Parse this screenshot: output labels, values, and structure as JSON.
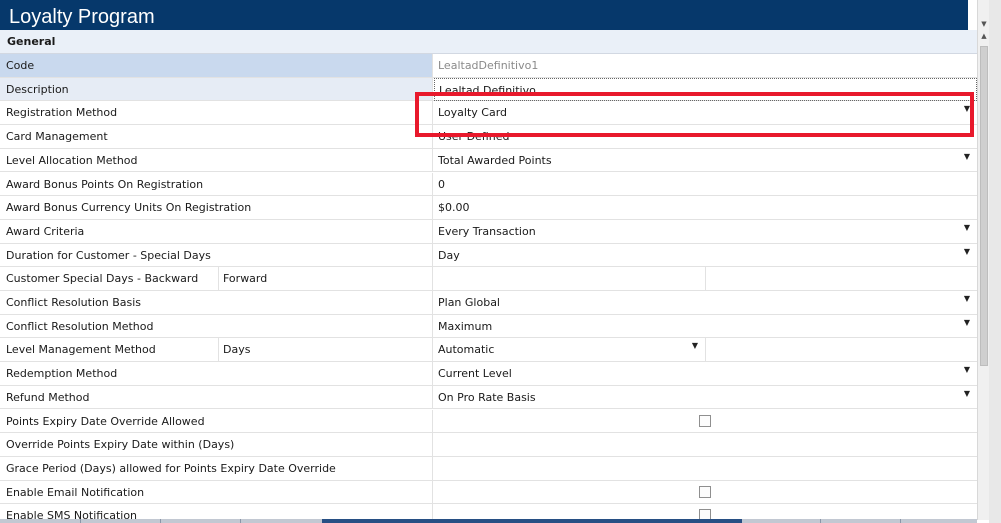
{
  "window": {
    "title": "Loyalty Program"
  },
  "category": {
    "label": "General"
  },
  "properties": {
    "code": {
      "label": "Code",
      "value": "LealtadDefinitivo1"
    },
    "description": {
      "label": "Description",
      "value": "Lealtad Definitivo"
    },
    "registration_method": {
      "label": "Registration Method",
      "value": "Loyalty Card"
    },
    "card_management": {
      "label": "Card Management",
      "value": "User Defined"
    },
    "level_allocation_method": {
      "label": "Level Allocation Method",
      "value": "Total Awarded Points"
    },
    "award_bonus_points": {
      "label": "Award Bonus Points On Registration",
      "value": "0"
    },
    "award_bonus_currency": {
      "label": "Award Bonus Currency Units On Registration",
      "value": "$0.00"
    },
    "award_criteria": {
      "label": "Award Criteria",
      "value": "Every Transaction"
    },
    "duration_special_days": {
      "label": "Duration for Customer - Special Days",
      "value": "Day"
    },
    "special_days_backward": {
      "label": "Customer Special Days - Backward",
      "sublabel": "Forward"
    },
    "conflict_resolution_basis": {
      "label": "Conflict Resolution Basis",
      "value": "Plan Global"
    },
    "conflict_resolution_method": {
      "label": "Conflict Resolution Method",
      "value": "Maximum"
    },
    "level_management_method": {
      "label": "Level Management Method",
      "sublabel": "Days",
      "value": "Automatic"
    },
    "redemption_method": {
      "label": "Redemption Method",
      "value": "Current Level"
    },
    "refund_method": {
      "label": "Refund Method",
      "value": "On Pro Rate Basis"
    },
    "points_expiry_override_allowed": {
      "label": "Points Expiry Date Override Allowed",
      "checked": false
    },
    "override_points_expiry_within": {
      "label": "Override Points Expiry Date within (Days)"
    },
    "grace_period": {
      "label": "Grace Period (Days) allowed for Points Expiry Date Override"
    },
    "enable_email_notification": {
      "label": "Enable Email Notification",
      "checked": false
    },
    "enable_sms_notification": {
      "label": "Enable SMS Notification",
      "checked": false
    }
  },
  "icons": {
    "dropdown": "▼",
    "scroll_up": "▲",
    "scroll_down": "▼"
  },
  "colors": {
    "title_bar": "#06386b",
    "highlight_box": "#e8192c",
    "selected_row": "#c9d9ee"
  }
}
